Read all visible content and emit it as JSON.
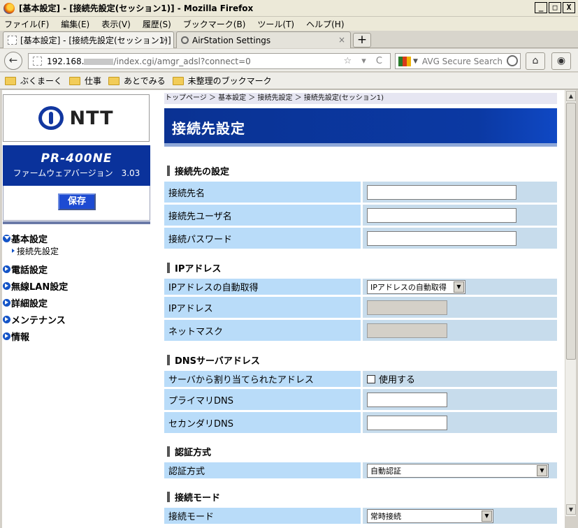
{
  "window": {
    "title": "[基本設定] - [接続先設定(セッション1)] - Mozilla Firefox",
    "controls": [
      "_",
      "□",
      "X"
    ]
  },
  "menu": [
    "ファイル(F)",
    "編集(E)",
    "表示(V)",
    "履歴(S)",
    "ブックマーク(B)",
    "ツール(T)",
    "ヘルプ(H)"
  ],
  "tabs": [
    {
      "label": "[基本設定] - [接続先設定(セッション1)]",
      "close": "×",
      "active": true
    },
    {
      "label": "AirStation Settings",
      "close": "×",
      "active": false
    }
  ],
  "new_tab_label": "+",
  "nav": {
    "back_icon": "←",
    "url_host": "192.168.",
    "url_path": "/index.cgi/amgr_adsl?connect=0",
    "url_right_icons": "☆ ▾ C",
    "search_placeholder": "AVG Secure Search",
    "home_icon": "⌂",
    "eye_icon": "◉"
  },
  "bookmarks": [
    "ぶくまーく",
    "仕事",
    "あとでみる",
    "未整理のブックマーク"
  ],
  "sidebar": {
    "logo_text": "NTT",
    "model": "PR-400NE",
    "firmware": "ファームウェアバージョン　3.03",
    "save_label": "保存",
    "items": [
      {
        "label": "基本設定",
        "expanded": true,
        "sub": [
          "接続先設定"
        ]
      },
      {
        "label": "電話設定",
        "expanded": false
      },
      {
        "label": "無線LAN設定",
        "expanded": false
      },
      {
        "label": "詳細設定",
        "expanded": false
      },
      {
        "label": "メンテナンス",
        "expanded": false
      },
      {
        "label": "情報",
        "expanded": false
      }
    ]
  },
  "main": {
    "breadcrumb": "トップページ ＞ 基本設定 ＞ 接続先設定 ＞ 接続先設定(セッション1)",
    "title": "接続先設定",
    "sections": {
      "conn": {
        "title": "接続先の設定",
        "name_label": "接続先名",
        "name_value": "",
        "user_label": "接続先ユーザ名",
        "user_value": "",
        "pass_label": "接続パスワード",
        "pass_value": ""
      },
      "ip": {
        "title": "IPアドレス",
        "auto_label": "IPアドレスの自動取得",
        "auto_value": "IPアドレスの自動取得",
        "addr_label": "IPアドレス",
        "mask_label": "ネットマスク"
      },
      "dns": {
        "title": "DNSサーバアドレス",
        "assigned_label": "サーバから割り当てられたアドレス",
        "use_label": "使用する",
        "primary_label": "プライマリDNS",
        "secondary_label": "セカンダリDNS"
      },
      "auth": {
        "title": "認証方式",
        "method_label": "認証方式",
        "method_value": "自動認証"
      },
      "mode": {
        "title": "接続モード",
        "mode_label": "接続モード",
        "mode_value": "常時接続"
      }
    }
  },
  "colors": {
    "header_blue": "#0a3293",
    "label_cell": "#b9dcf9",
    "value_cell": "#c7dcec",
    "save_button": "#1d4bd2"
  }
}
